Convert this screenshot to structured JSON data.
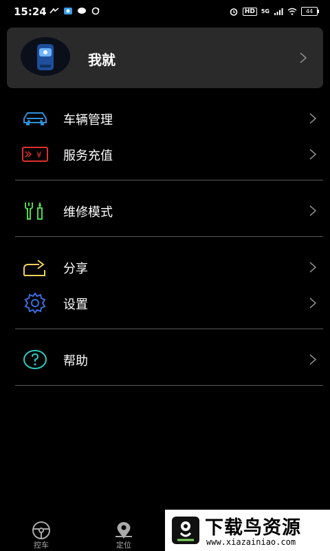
{
  "status_bar": {
    "time": "15:24",
    "hd": "HD",
    "network": "5G",
    "battery": "44"
  },
  "profile": {
    "name": "我就"
  },
  "menu": {
    "vehicle_management": "车辆管理",
    "service_recharge": "服务充值",
    "repair_mode": "维修模式",
    "share": "分享",
    "settings": "设置",
    "help": "帮助"
  },
  "colors": {
    "vehicle_icon": "#2f8fd8",
    "recharge_icon": "#e03030",
    "repair_icon": "#4fd84f",
    "share_icon": "#f0d060",
    "settings_icon": "#3a6fe0",
    "help_icon": "#30c8c0"
  },
  "bottom_nav": {
    "tabs": [
      {
        "label": "控车",
        "icon": "steering-wheel-icon"
      },
      {
        "label": "定位",
        "icon": "location-pin-icon"
      }
    ]
  },
  "watermark": {
    "title": "下载鸟资源",
    "url": "www.xiazainiao.com"
  }
}
